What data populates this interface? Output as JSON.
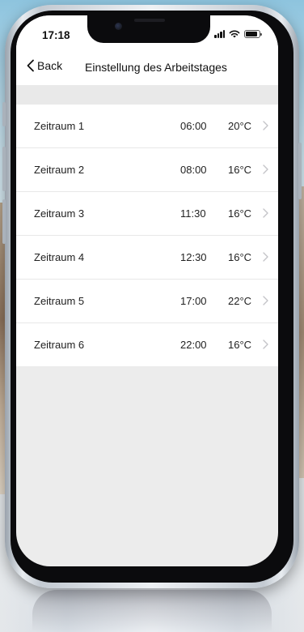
{
  "status_bar": {
    "time": "17:18"
  },
  "nav": {
    "back_label": "Back",
    "title": "Einstellung des Arbeitstages"
  },
  "periods": [
    {
      "label": "Zeitraum 1",
      "time": "06:00",
      "temp": "20°C"
    },
    {
      "label": "Zeitraum 2",
      "time": "08:00",
      "temp": "16°C"
    },
    {
      "label": "Zeitraum 3",
      "time": "11:30",
      "temp": "16°C"
    },
    {
      "label": "Zeitraum 4",
      "time": "12:30",
      "temp": "16°C"
    },
    {
      "label": "Zeitraum 5",
      "time": "17:00",
      "temp": "22°C"
    },
    {
      "label": "Zeitraum 6",
      "time": "22:00",
      "temp": "16°C"
    }
  ],
  "colors": {
    "background": "#ececec",
    "row_background": "#ffffff",
    "chevron": "#c4c4c8"
  },
  "icons": {
    "back": "chevron-left-icon",
    "row_disclosure": "chevron-right-icon",
    "signal": "signal-icon",
    "wifi": "wifi-icon",
    "battery": "battery-icon"
  }
}
